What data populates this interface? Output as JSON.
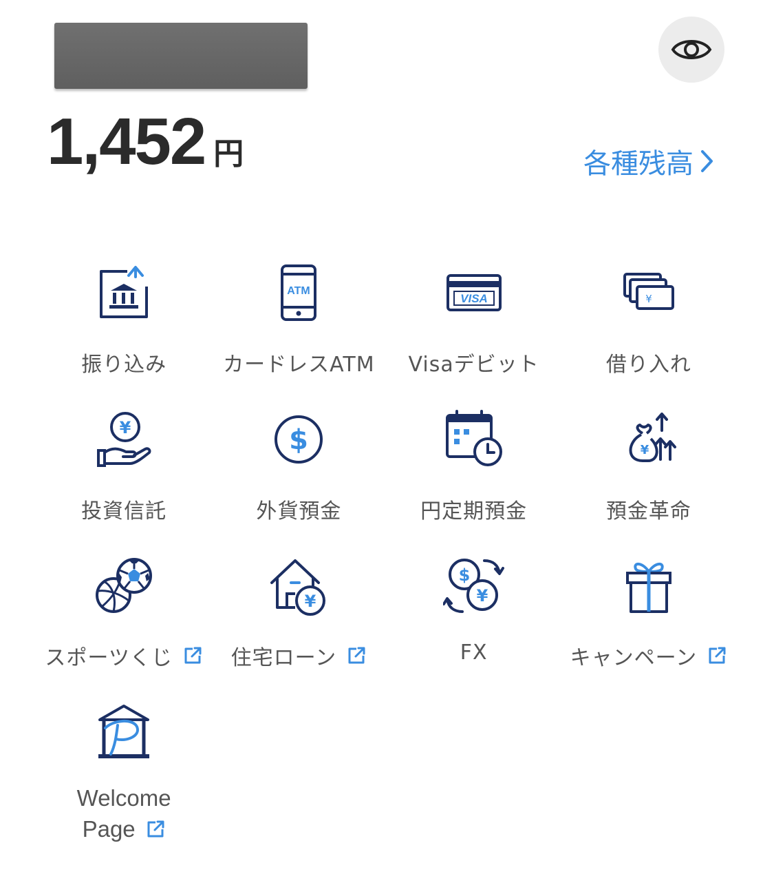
{
  "account": {
    "redacted_name": ""
  },
  "balance": {
    "amount": "1,452",
    "unit": "円"
  },
  "balances_link": {
    "label": "各種残高"
  },
  "menu": {
    "items": [
      {
        "label": "振り込み",
        "icon": "bank-transfer-icon",
        "external": false
      },
      {
        "label": "カードレスATM",
        "icon": "phone-atm-icon",
        "external": false
      },
      {
        "label": "Visaデビット",
        "icon": "visa-card-icon",
        "external": false
      },
      {
        "label": "借り入れ",
        "icon": "loan-cards-icon",
        "external": false
      },
      {
        "label": "投資信託",
        "icon": "hand-coin-icon",
        "external": false
      },
      {
        "label": "外貨預金",
        "icon": "dollar-coin-icon",
        "external": false
      },
      {
        "label": "円定期預金",
        "icon": "calendar-clock-icon",
        "external": false
      },
      {
        "label": "預金革命",
        "icon": "money-bag-growth-icon",
        "external": false
      },
      {
        "label": "スポーツくじ",
        "icon": "sports-balls-icon",
        "external": true
      },
      {
        "label": "住宅ローン",
        "icon": "house-yen-icon",
        "external": true
      },
      {
        "label": "FX",
        "icon": "currency-exchange-icon",
        "external": false
      },
      {
        "label": "キャンペーン",
        "icon": "gift-icon",
        "external": true
      }
    ],
    "welcome": {
      "line1": "Welcome",
      "line2": "Page",
      "icon": "bank-p-logo-icon",
      "external": true
    }
  },
  "colors": {
    "navy": "#1c2f63",
    "accent": "#3a8de0",
    "text": "#555555"
  }
}
